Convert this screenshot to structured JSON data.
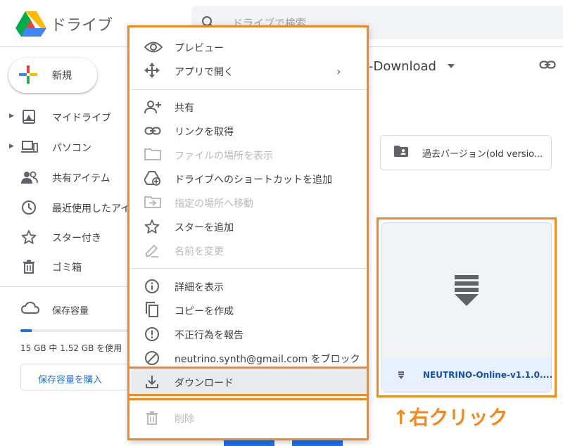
{
  "header": {
    "app_title": "ドライブ",
    "search_placeholder": "ドライブで検索"
  },
  "sidebar": {
    "new_label": "新規",
    "items": [
      {
        "label": "マイドライブ",
        "icon": "my-drive-icon"
      },
      {
        "label": "パソコン",
        "icon": "computer-icon"
      },
      {
        "label": "共有アイテム",
        "icon": "shared-icon"
      },
      {
        "label": "最近使用したアイ",
        "icon": "clock-icon"
      },
      {
        "label": "スター付き",
        "icon": "star-icon"
      },
      {
        "label": "ゴミ箱",
        "icon": "trash-icon"
      }
    ],
    "storage": {
      "label": "保存容量",
      "usage_text": "15 GB 中 1.52 GB を使用",
      "used_fraction": 0.1,
      "buy_label": "保存容量を購入"
    }
  },
  "main": {
    "folder_title": "-Download",
    "folder_card_label": "過去バージョン(old versio...",
    "file_name": "NEUTRINO-Online-v1.1.0...."
  },
  "context_menu": {
    "items": [
      {
        "label": "プレビュー",
        "icon": "eye-icon",
        "disabled": false
      },
      {
        "label": "アプリで開く",
        "icon": "move-arrows-icon",
        "disabled": false,
        "submenu": true
      },
      {
        "label": "共有",
        "icon": "person-add-icon",
        "disabled": false
      },
      {
        "label": "リンクを取得",
        "icon": "link-icon",
        "disabled": false
      },
      {
        "label": "ファイルの場所を表示",
        "icon": "folder-outline-icon",
        "disabled": true
      },
      {
        "label": "ドライブへのショートカットを追加",
        "icon": "drive-shortcut-icon",
        "disabled": false
      },
      {
        "label": "指定の場所へ移動",
        "icon": "folder-move-icon",
        "disabled": true
      },
      {
        "label": "スターを追加",
        "icon": "star-icon",
        "disabled": false
      },
      {
        "label": "名前を変更",
        "icon": "pencil-icon",
        "disabled": true
      },
      {
        "label": "詳細を表示",
        "icon": "info-icon",
        "disabled": false
      },
      {
        "label": "コピーを作成",
        "icon": "copy-icon",
        "disabled": false
      },
      {
        "label": "不正行為を報告",
        "icon": "report-icon",
        "disabled": false
      },
      {
        "label": "neutrino.synth@gmail.com をブロック",
        "icon": "block-icon",
        "disabled": false
      },
      {
        "label": "ダウンロード",
        "icon": "download-icon",
        "disabled": false,
        "highlighted": true
      },
      {
        "label": "削除",
        "icon": "trash-icon",
        "disabled": true
      }
    ]
  },
  "annotation": {
    "caption": "↑右クリック",
    "color": "#f08a24"
  }
}
